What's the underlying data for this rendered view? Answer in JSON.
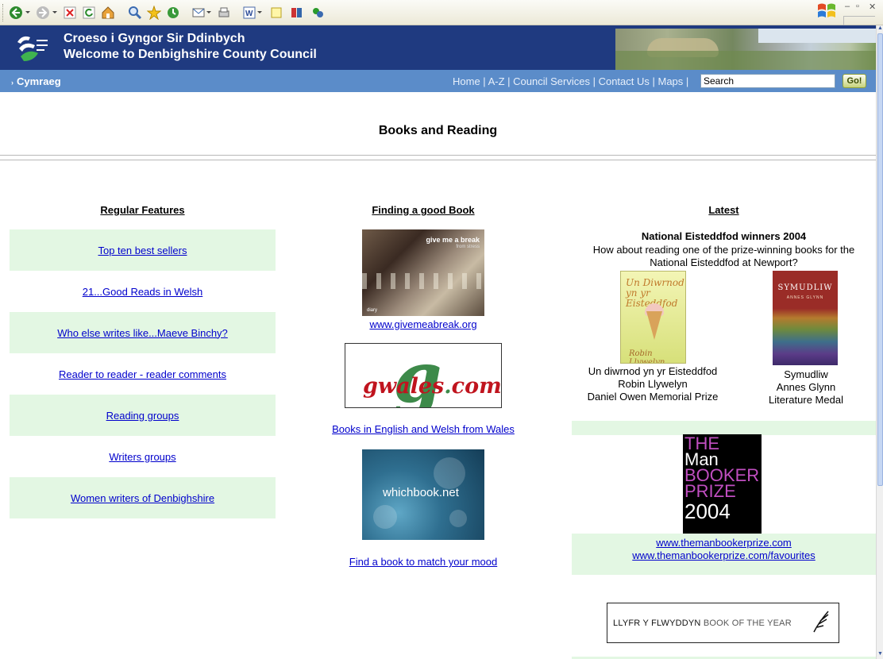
{
  "header": {
    "title_cy": "Croeso i Gyngor Sir Ddinbych",
    "title_en": "Welcome to Denbighshire County Council"
  },
  "nav": {
    "language_link": "Cymraeg",
    "links": [
      "Home",
      "A-Z",
      "Council Services",
      "Contact Us",
      "Maps"
    ],
    "search_value": "Search",
    "go_label": "Go!"
  },
  "page": {
    "title": "Books and Reading"
  },
  "regular_features": {
    "heading": "Regular Features",
    "items": [
      "Top ten best sellers",
      "21...Good Reads in Welsh",
      "Who else writes like...Maeve Binchy?",
      "Reader to reader - reader comments",
      "Reading groups",
      "Writers groups",
      "Women writers of Denbighshire"
    ]
  },
  "finding": {
    "heading": "Finding a good Book",
    "givemeabreak_link": "www.givemeabreak.org",
    "givemeabreak_img_text": "give me a break",
    "givemeabreak_img_sub": "from stress",
    "givemeabreak_img_foot": "diary",
    "gwales_img_text": "gwales",
    "gwales_img_com": "com",
    "gwales_link": "Books in English and Welsh from Wales",
    "whichbook_img_text": "whichbook.net",
    "whichbook_link": "Find a book to match your mood"
  },
  "latest": {
    "heading": "Latest",
    "eisteddfod_title": "National Eisteddfod winners 2004",
    "eisteddfod_intro": "How about reading one of the prize-winning books for the National Eisteddfod at Newport?",
    "book1": {
      "title": "Un diwrnod yn yr Eisteddfod",
      "author": "Robin Llywelyn",
      "prize": "Daniel Owen Memorial Prize",
      "cover_title": "Un Diwrnod yn yr Eisteddfod",
      "cover_author": "Robin Llywelyn"
    },
    "book2": {
      "title": "Symudliw",
      "author": "Annes Glynn",
      "prize": "Literature Medal",
      "cover_title": "SYMUDLIW",
      "cover_author": "ANNES GLYNN"
    },
    "booker_lines": [
      "THE",
      "Man",
      "BOOKER",
      "PRIZE",
      "2004"
    ],
    "booker_link1": "www.themanbookerprize.com",
    "booker_link2": "www.themanbookerprize.com/favourites",
    "llyfr_text": "LLYFR Y FLWYDDYN",
    "llyfr_text2": "BOOK OF THE YEAR"
  },
  "colors": {
    "header_bg": "#1f3a80",
    "nav_bg": "#5b8cc9",
    "row_shade": "#e3f7e3",
    "link": "#0000cc"
  }
}
